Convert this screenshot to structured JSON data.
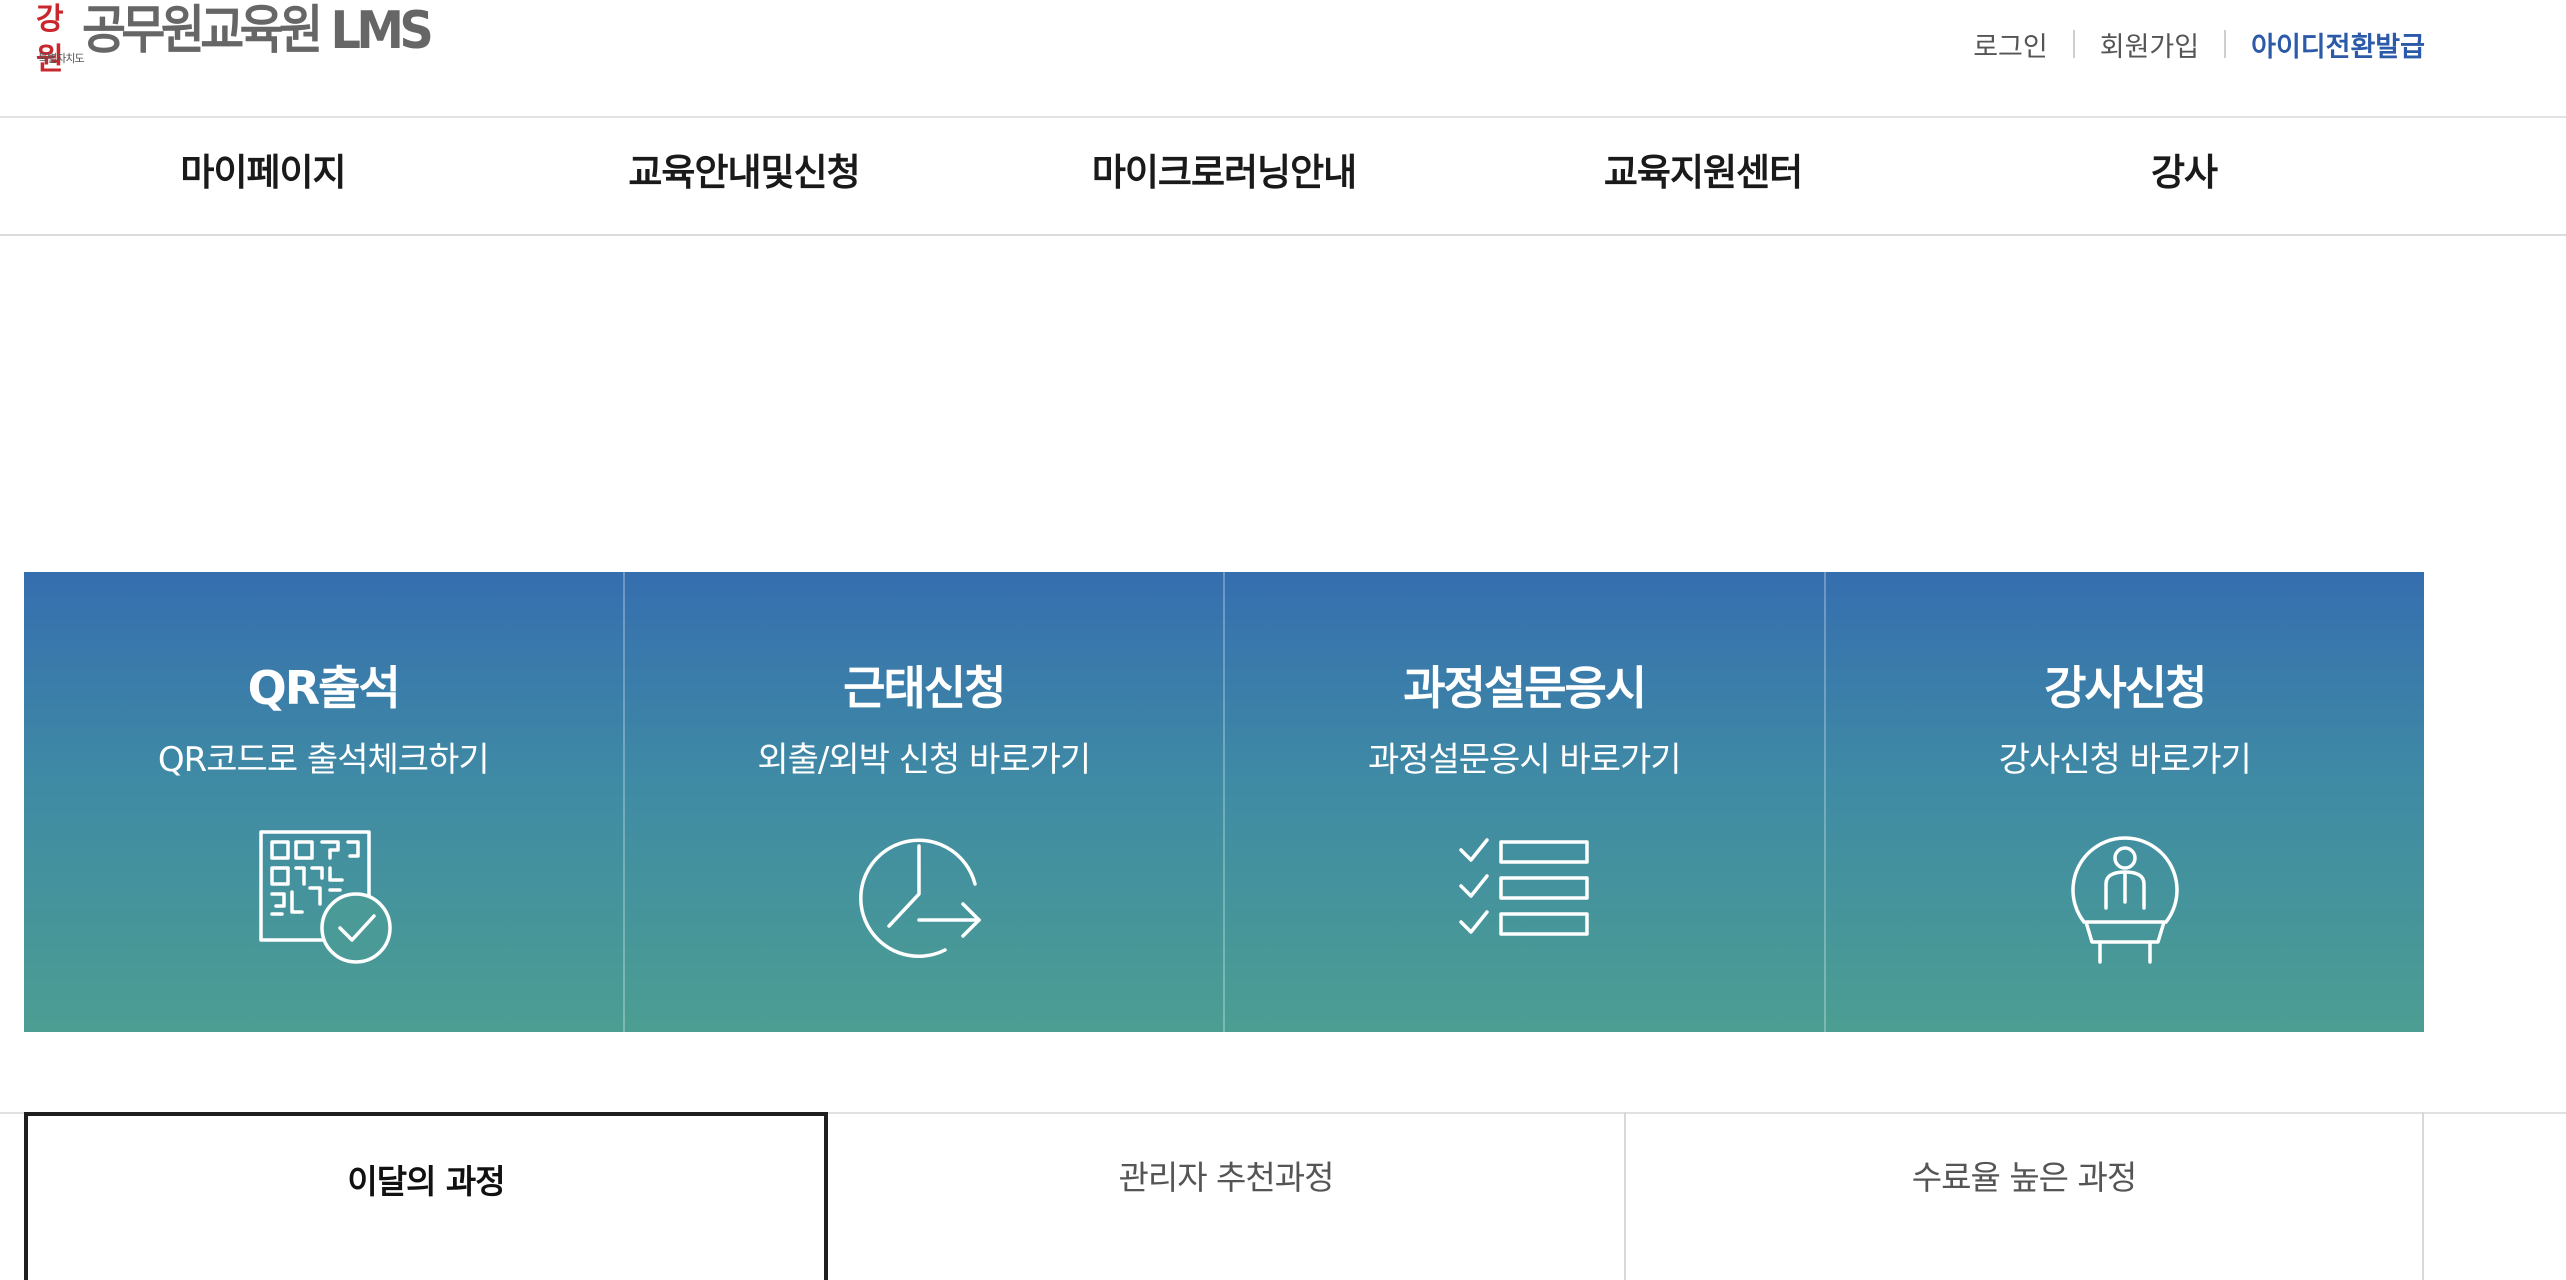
{
  "logo": {
    "mark": "강원",
    "mark_sub": "특별자치도",
    "title": "공무원교육원 LMS"
  },
  "util_menu": {
    "login": "로그인",
    "signup": "회원가입",
    "id_convert": "아이디전환발급",
    "accent_color": "#2b5aa8"
  },
  "gnb": {
    "items": [
      {
        "label": "마이페이지"
      },
      {
        "label": "교육안내및신청"
      },
      {
        "label": "마이크로러닝안내"
      },
      {
        "label": "교육지원센터"
      },
      {
        "label": "강사"
      }
    ]
  },
  "quick_menu": {
    "colors": {
      "top": "#356eaf",
      "bottom": "#4c9e92"
    },
    "tiles": [
      {
        "title": "QR출석",
        "desc": "QR코드로 출석체크하기",
        "icon": "qr-check-icon"
      },
      {
        "title": "근태신청",
        "desc": "외출/외박 신청 바로가기",
        "icon": "clock-arrow-icon"
      },
      {
        "title": "과정설문응시",
        "desc": "과정설문응시 바로가기",
        "icon": "checklist-icon"
      },
      {
        "title": "강사신청",
        "desc": "강사신청 바로가기",
        "icon": "lecturer-podium-icon"
      }
    ]
  },
  "course_tabs": {
    "active_index": 0,
    "items": [
      {
        "label": "이달의 과정"
      },
      {
        "label": "관리자 추천과정"
      },
      {
        "label": "수료율 높은 과정"
      }
    ]
  }
}
